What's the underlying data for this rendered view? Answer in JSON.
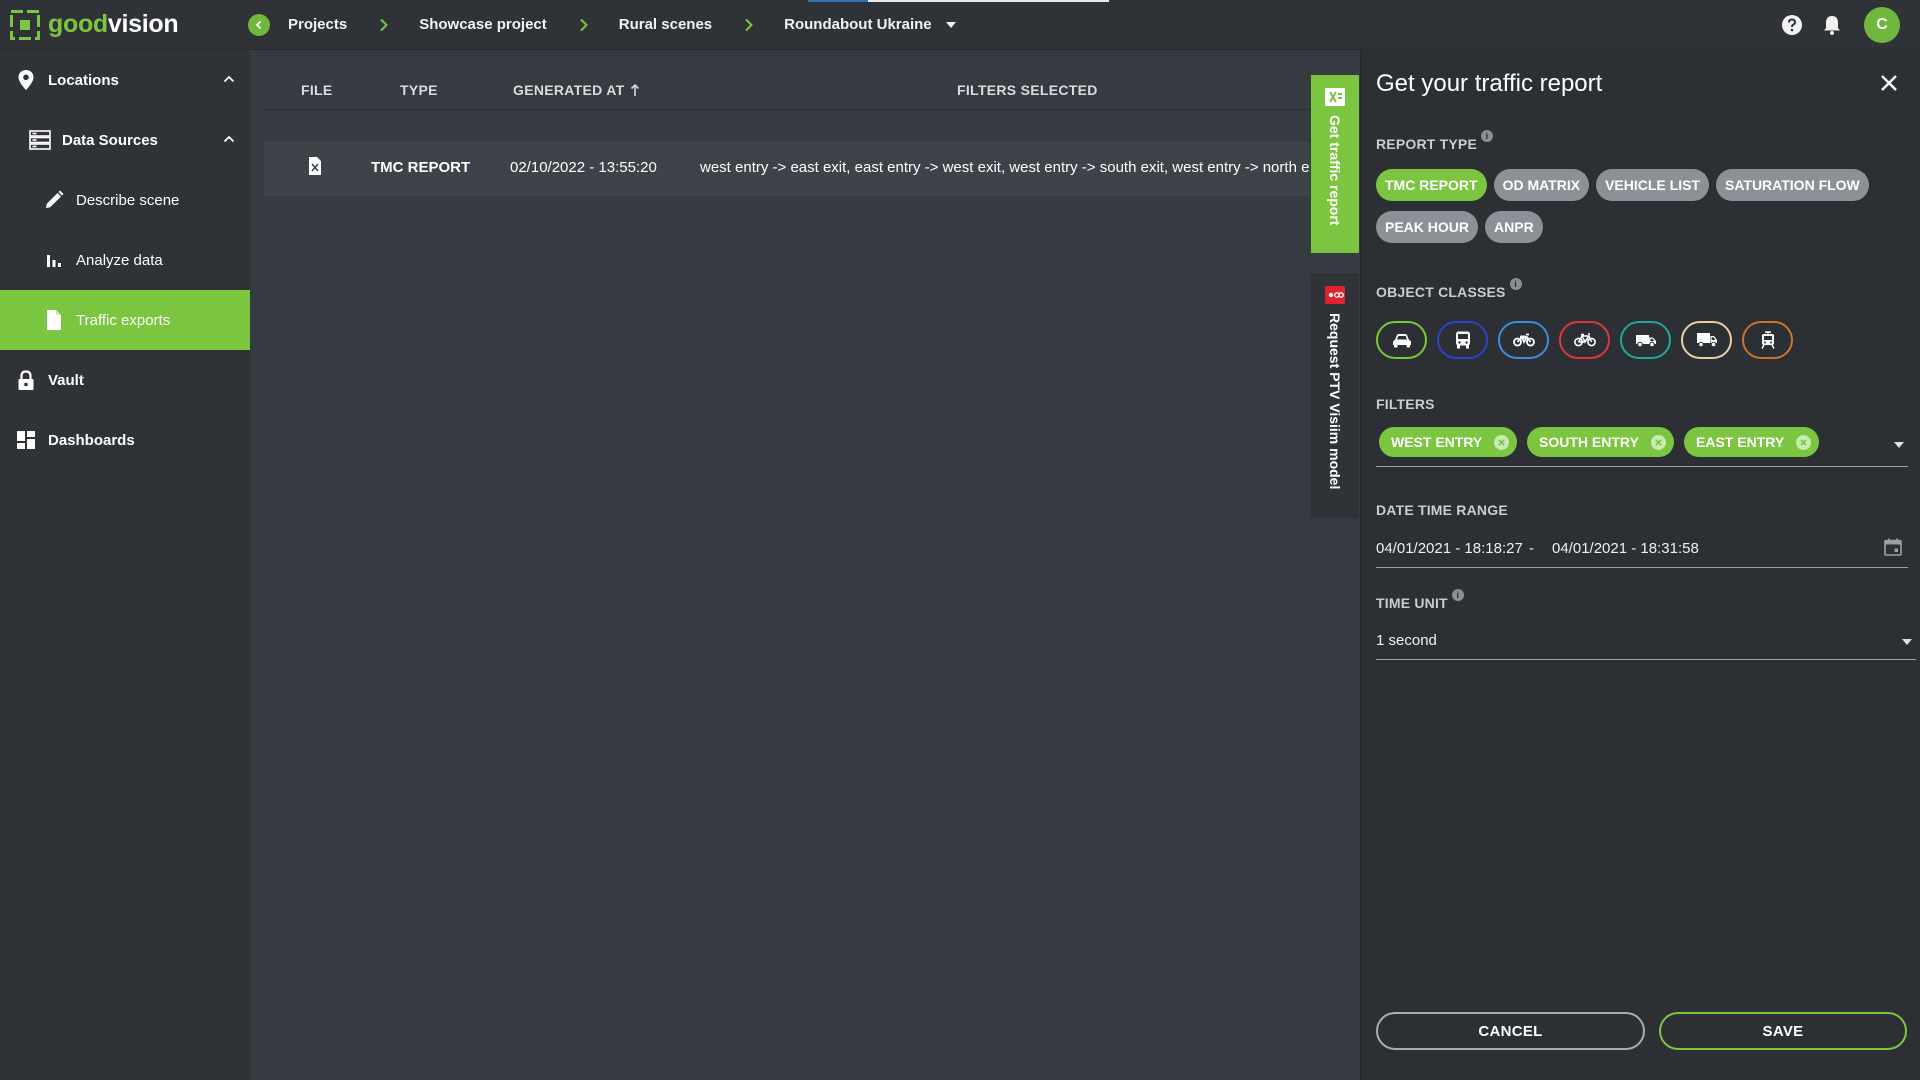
{
  "app": {
    "logo_part1": "good",
    "logo_part2": "vision"
  },
  "breadcrumbs": [
    {
      "label": "Projects"
    },
    {
      "label": "Showcase project"
    },
    {
      "label": "Rural scenes"
    },
    {
      "label": "Roundabout Ukraine"
    }
  ],
  "user": {
    "initial": "C"
  },
  "sidebar": {
    "items": [
      {
        "label": "Locations"
      },
      {
        "label": "Data Sources"
      },
      {
        "label": "Describe scene"
      },
      {
        "label": "Analyze data"
      },
      {
        "label": "Traffic exports"
      },
      {
        "label": "Vault"
      },
      {
        "label": "Dashboards"
      }
    ]
  },
  "table": {
    "headers": {
      "file": "FILE",
      "type": "TYPE",
      "generated_at": "GENERATED AT",
      "filters": "FILTERS SELECTED"
    },
    "rows": [
      {
        "type": "TMC REPORT",
        "generated_at": "02/10/2022 - 13:55:20",
        "filters": "west entry -> east exit, east entry -> west exit, west entry -> south exit, west entry -> north exit"
      }
    ]
  },
  "side_tabs": {
    "traffic_report": "Get traffic report",
    "ptv": "Request PTV Visiim model"
  },
  "panel": {
    "title": "Get your traffic report",
    "report_type_label": "REPORT TYPE",
    "report_types": [
      {
        "label": "TMC REPORT",
        "selected": true
      },
      {
        "label": "OD MATRIX",
        "selected": false
      },
      {
        "label": "VEHICLE LIST",
        "selected": false
      },
      {
        "label": "SATURATION FLOW",
        "selected": false
      },
      {
        "label": "PEAK HOUR",
        "selected": false
      },
      {
        "label": "ANPR",
        "selected": false
      }
    ],
    "object_classes_label": "OBJECT CLASSES",
    "object_classes": [
      {
        "icon": "car-icon",
        "color": "#7bc540"
      },
      {
        "icon": "bus-icon",
        "color": "#2f3fd0"
      },
      {
        "icon": "motorcycle-icon",
        "color": "#3a8fd8"
      },
      {
        "icon": "bicycle-icon",
        "color": "#d83a3a"
      },
      {
        "icon": "van-icon",
        "color": "#1fa89a"
      },
      {
        "icon": "truck-icon",
        "color": "#e8d0a0"
      },
      {
        "icon": "tram-icon",
        "color": "#c9742a"
      }
    ],
    "filters_label": "FILTERS",
    "filters": [
      {
        "label": "WEST ENTRY"
      },
      {
        "label": "SOUTH ENTRY"
      },
      {
        "label": "EAST ENTRY"
      }
    ],
    "date_range_label": "DATE TIME RANGE",
    "date_from": "04/01/2021 - 18:18:27",
    "date_separator": "-",
    "date_to": "04/01/2021 - 18:31:58",
    "time_unit_label": "TIME UNIT",
    "time_unit": "1 second",
    "cancel_label": "CANCEL",
    "save_label": "SAVE"
  },
  "colors": {
    "accent": "#7bc540",
    "background": "#363a41",
    "sidebar": "#2f3338",
    "panel": "#2c3035"
  }
}
